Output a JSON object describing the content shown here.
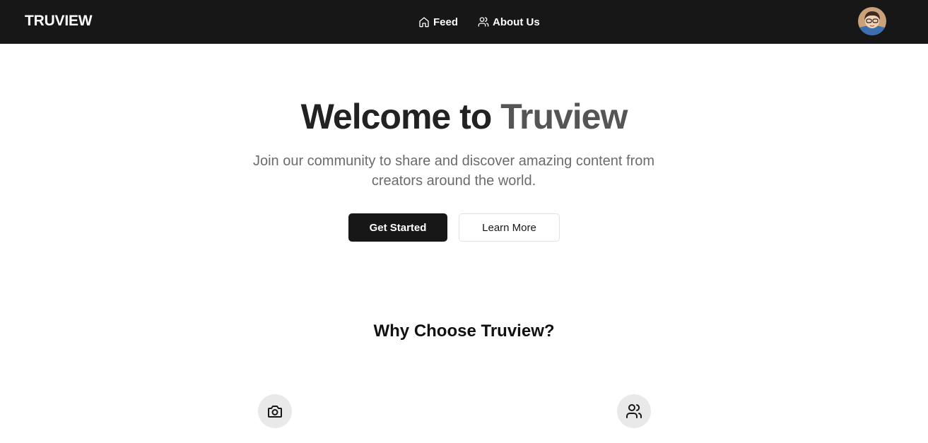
{
  "navbar": {
    "brand": "TRUVIEW",
    "links": [
      {
        "label": "Feed",
        "icon": "home-icon"
      },
      {
        "label": "About Us",
        "icon": "users-icon"
      }
    ],
    "avatar": "user-avatar"
  },
  "hero": {
    "title_part1": "Welcome to",
    "title_part2": "Truview",
    "subtitle": "Join our community to share and discover amazing content from creators around the world.",
    "primary_button": "Get Started",
    "secondary_button": "Learn More"
  },
  "features": {
    "title": "Why Choose Truview?",
    "icons": [
      "camera-icon",
      "users-icon"
    ]
  },
  "colors": {
    "navbar_bg": "#171717",
    "primary_button_bg": "#171717",
    "icon_circle_bg": "#e9e9e9"
  }
}
